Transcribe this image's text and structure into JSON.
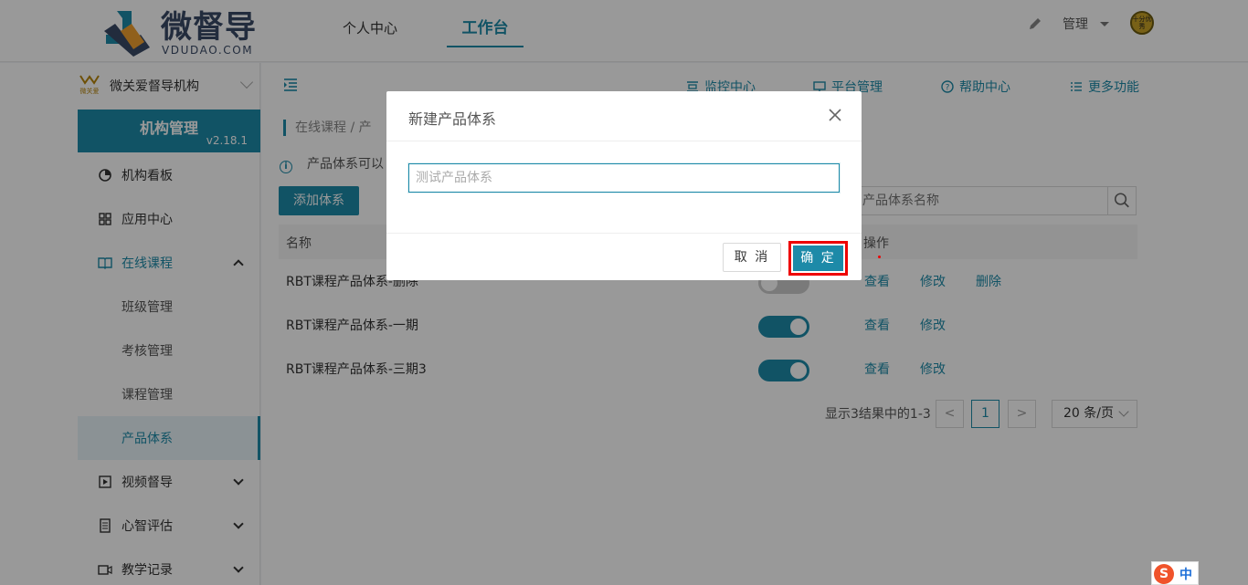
{
  "header": {
    "logo_title": "微督导",
    "logo_sub": "VDUDAO.COM",
    "tabs": [
      {
        "label": "个人中心"
      },
      {
        "label": "工作台"
      }
    ],
    "user_menu": "管理",
    "avatar_text": "十分优秀"
  },
  "sidebar": {
    "org_logo_text": "微关爱",
    "org_name": "微关爱督导机构",
    "card_title": "机构管理",
    "version": "v2.18.1",
    "items": [
      {
        "label": "机构看板",
        "icon": "dashboard-icon"
      },
      {
        "label": "应用中心",
        "icon": "apps-icon"
      },
      {
        "label": "在线课程",
        "icon": "book-icon"
      },
      {
        "label": "班级管理"
      },
      {
        "label": "考核管理"
      },
      {
        "label": "课程管理"
      },
      {
        "label": "产品体系"
      },
      {
        "label": "视频督导",
        "icon": "video-play-icon"
      },
      {
        "label": "心智评估",
        "icon": "assessment-icon"
      },
      {
        "label": "教学记录",
        "icon": "camera-icon"
      }
    ]
  },
  "toolbar": {
    "items": [
      {
        "label": "监控中心",
        "icon": "monitor-icon"
      },
      {
        "label": "平台管理",
        "icon": "desktop-icon"
      },
      {
        "label": "帮助中心",
        "icon": "help-icon"
      },
      {
        "label": "更多功能",
        "icon": "list-icon"
      }
    ]
  },
  "content": {
    "breadcrumb": "在线课程 / 产",
    "tip": "产品体系可以",
    "add_button": "添加体系",
    "search_placeholder": "产品体系名称",
    "columns": {
      "name": "名称",
      "actions": "操作"
    },
    "rows": [
      {
        "name": "RBT课程产品体系-删除",
        "enabled": false,
        "actions": [
          "查看",
          "修改",
          "删除"
        ]
      },
      {
        "name": "RBT课程产品体系-一期",
        "enabled": true,
        "actions": [
          "查看",
          "修改"
        ]
      },
      {
        "name": "RBT课程产品体系-三期3",
        "enabled": true,
        "actions": [
          "查看",
          "修改"
        ]
      }
    ],
    "pager": {
      "summary": "显示3结果中的1-3",
      "prev": "<",
      "current": "1",
      "next": ">",
      "page_size": "20 条/页"
    }
  },
  "modal": {
    "title": "新建产品体系",
    "input_value": "",
    "input_placeholder": "测试产品体系",
    "cancel_label": "取 消",
    "ok_label": "确 定"
  },
  "ime": {
    "label": "中"
  }
}
